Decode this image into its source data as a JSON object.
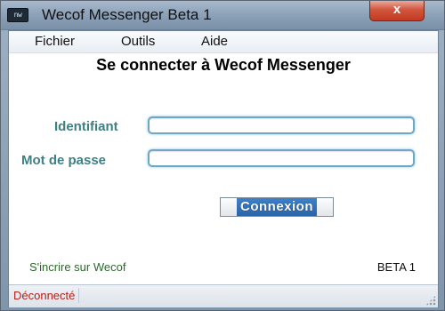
{
  "window": {
    "title": "Wecof Messenger Beta 1",
    "app_icon_text": "nw",
    "close_glyph": "x"
  },
  "menu": [
    {
      "label": "Fichier"
    },
    {
      "label": "Outils"
    },
    {
      "label": "Aide"
    }
  ],
  "login": {
    "heading": "Se connecter à Wecof Messenger",
    "username_label": "Identifiant",
    "username_value": "",
    "password_label": "Mot de passe",
    "password_value": "",
    "submit_label": "Connexion"
  },
  "footer": {
    "register_link": "S'incrire sur Wecof",
    "version": "BETA 1"
  },
  "status": {
    "text": "Déconnecté"
  },
  "colors": {
    "label_accent": "#3d7f83",
    "status_red": "#b0221b",
    "link_green": "#2c6a2c",
    "button_blue": "#2a63a8"
  }
}
